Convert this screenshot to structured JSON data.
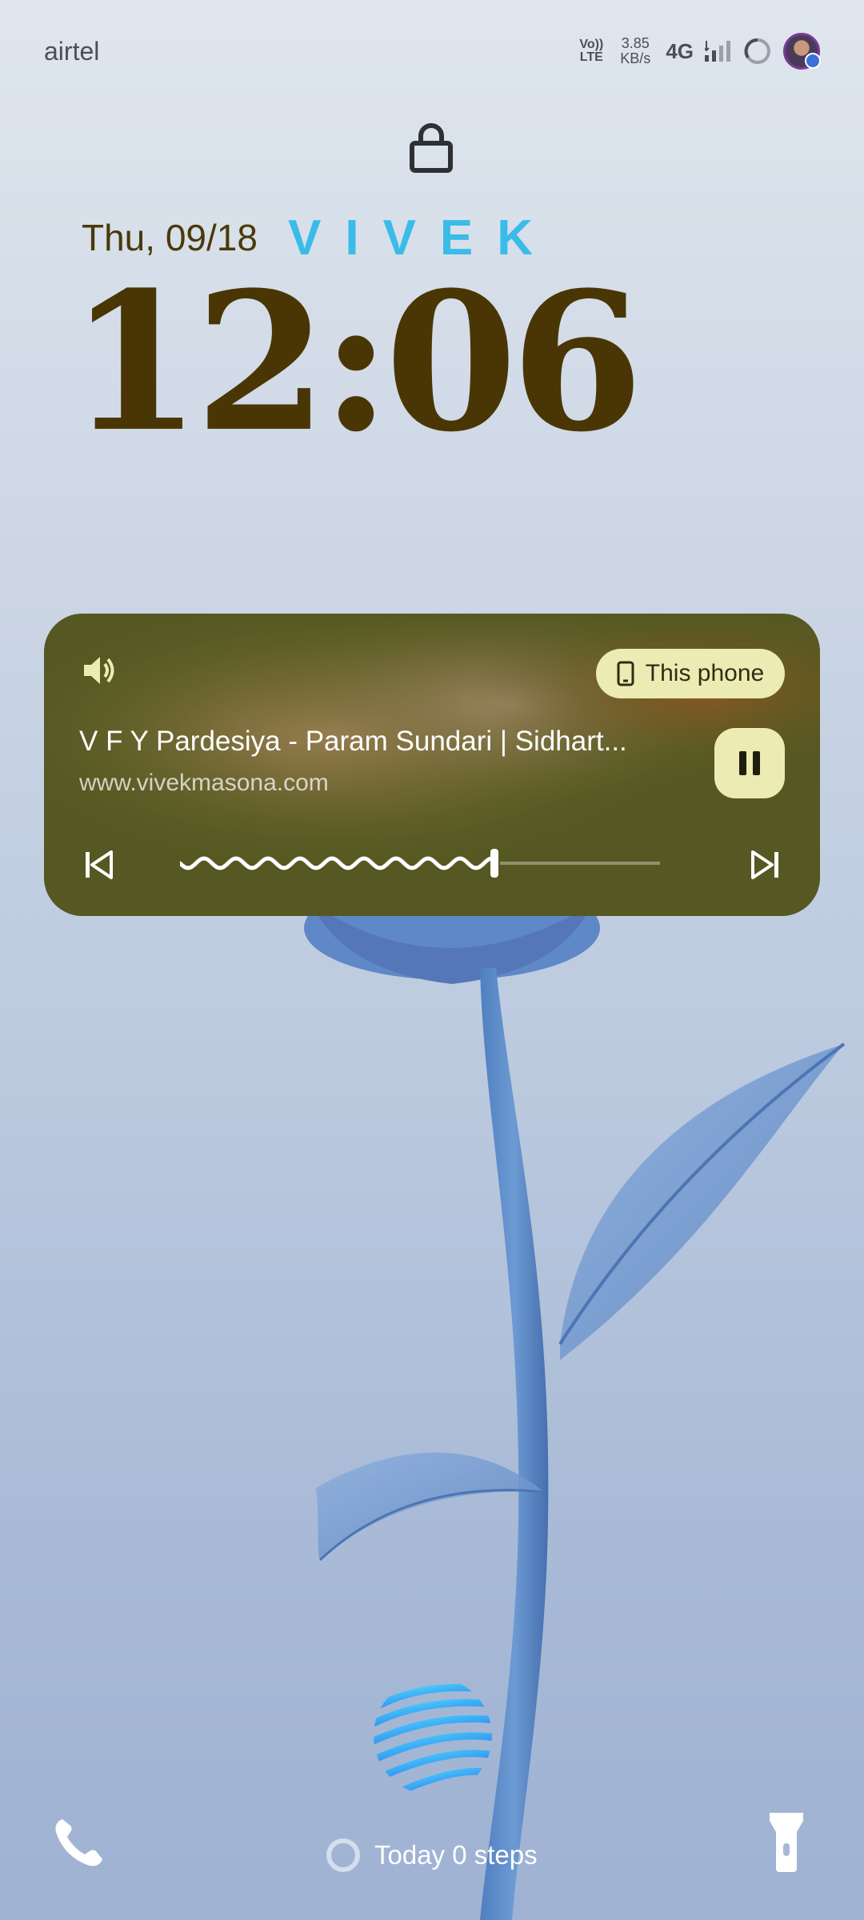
{
  "status_bar": {
    "carrier": "airtel",
    "volte": [
      "Vo))",
      "LTE"
    ],
    "speed": [
      "3.85",
      "KB/s"
    ],
    "network": "4G"
  },
  "lockscreen": {
    "date": "Thu, 09/18",
    "owner_text": "VIVEK",
    "time": "12:06"
  },
  "media": {
    "output_device": "This phone",
    "title": "V F Y Pardesiya - Param Sundari | Sidhart...",
    "subtitle": "www.vivekmasona.com",
    "playback_progress": 0.65,
    "state": "playing"
  },
  "bottom_bar": {
    "steps_text": "Today 0 steps"
  },
  "colors": {
    "clock": "#4a3605",
    "owner_text": "#3bbbe8",
    "chip": "#ecebb4"
  },
  "icons": [
    "lock-icon",
    "volume-icon",
    "phone-icon",
    "pause-icon",
    "previous-icon",
    "next-icon",
    "call-icon",
    "flashlight-icon",
    "globe-icon"
  ]
}
